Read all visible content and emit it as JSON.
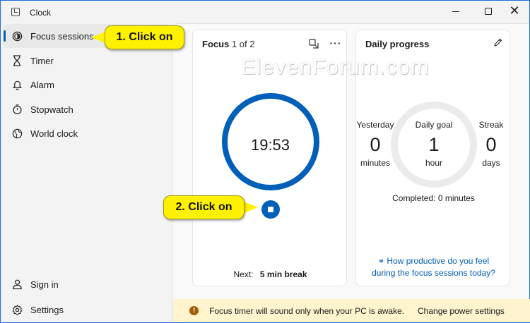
{
  "app": {
    "title": "Clock"
  },
  "sidebar": {
    "items": [
      {
        "label": "Focus sessions",
        "icon": "focus-icon",
        "active": true
      },
      {
        "label": "Timer",
        "icon": "hourglass-icon"
      },
      {
        "label": "Alarm",
        "icon": "bell-icon"
      },
      {
        "label": "Stopwatch",
        "icon": "stopwatch-icon"
      },
      {
        "label": "World clock",
        "icon": "globe-icon"
      }
    ],
    "bottom": [
      {
        "label": "Sign in",
        "icon": "person-icon"
      },
      {
        "label": "Settings",
        "icon": "gear-icon"
      }
    ]
  },
  "focus": {
    "title": "Focus",
    "counter": "1 of 2",
    "time": "19:53",
    "next_label": "Next:",
    "next_value": "5 min break",
    "accent": "#005fb8"
  },
  "progress": {
    "title": "Daily progress",
    "yesterday": {
      "label": "Yesterday",
      "value": "0",
      "unit": "minutes"
    },
    "goal": {
      "label": "Daily goal",
      "value": "1",
      "unit": "hour"
    },
    "streak": {
      "label": "Streak",
      "value": "0",
      "unit": "days"
    },
    "completed": "Completed: 0 minutes",
    "feedback_line1": "How productive do you feel",
    "feedback_line2": "during the focus sessions today?"
  },
  "banner": {
    "text": "Focus timer will sound only when your PC is awake.",
    "link": "Change power settings",
    "color": "#fff4ce"
  },
  "watermark": "ElevenForum.com",
  "callouts": {
    "one": "1. Click on",
    "two": "2. Click on",
    "color": "#fff200"
  }
}
